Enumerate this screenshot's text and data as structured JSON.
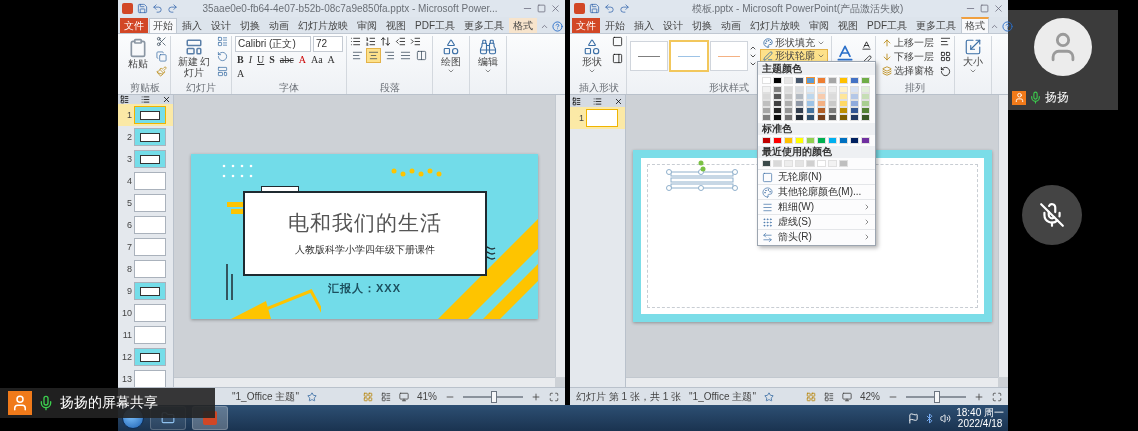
{
  "windows": [
    {
      "title": "35aae0e0-fb64-4e07-b52b-08c7a9e850fa.pptx - Microsoft Power...",
      "tabs": [
        {
          "label": "文件",
          "kind": "file",
          "selected": false
        },
        {
          "label": "开始",
          "kind": "normal",
          "selected": true
        },
        {
          "label": "插入",
          "kind": "normal",
          "selected": false
        },
        {
          "label": "设计",
          "kind": "normal",
          "selected": false
        },
        {
          "label": "切换",
          "kind": "normal",
          "selected": false
        },
        {
          "label": "动画",
          "kind": "normal",
          "selected": false
        },
        {
          "label": "幻灯片放映",
          "kind": "normal",
          "selected": false
        },
        {
          "label": "审阅",
          "kind": "normal",
          "selected": false
        },
        {
          "label": "视图",
          "kind": "normal",
          "selected": false
        },
        {
          "label": "PDF工具",
          "kind": "normal",
          "selected": false
        },
        {
          "label": "更多工具",
          "kind": "normal",
          "selected": false
        },
        {
          "label": "格式",
          "kind": "contextual",
          "selected": false
        }
      ],
      "groups": [
        {
          "kind": "clipboard",
          "label": "剪贴板",
          "button": "粘贴"
        },
        {
          "kind": "new_slide",
          "label": "幻灯片",
          "button": "新建 幻灯片"
        },
        {
          "kind": "font",
          "label": "字体",
          "font_name": "Calibri (正文)",
          "font_size": "72",
          "format_buttons": [
            "B",
            "I",
            "U",
            "S",
            "abc",
            "A",
            "Aa",
            "A",
            "A"
          ]
        },
        {
          "kind": "paragraph",
          "label": "段落",
          "alignments": [
            {
              "selected": false
            },
            {
              "selected": true
            },
            {
              "selected": false
            },
            {
              "selected": false
            },
            {
              "selected": false
            }
          ]
        },
        {
          "kind": "drawing",
          "button": "绘图"
        },
        {
          "kind": "editing",
          "button": "编辑"
        }
      ],
      "slides": [
        {
          "number": "1",
          "kind": "accent",
          "selected": true
        },
        {
          "number": "2",
          "kind": "accent",
          "selected": false
        },
        {
          "number": "3",
          "kind": "accent",
          "selected": false
        },
        {
          "number": "4",
          "kind": "plain",
          "selected": false
        },
        {
          "number": "5",
          "kind": "plain",
          "selected": false
        },
        {
          "number": "6",
          "kind": "plain",
          "selected": false
        },
        {
          "number": "7",
          "kind": "plain",
          "selected": false
        },
        {
          "number": "8",
          "kind": "plain",
          "selected": false
        },
        {
          "number": "9",
          "kind": "accent",
          "selected": false
        },
        {
          "number": "10",
          "kind": "plain",
          "selected": false
        },
        {
          "number": "11",
          "kind": "plain",
          "selected": false
        },
        {
          "number": "12",
          "kind": "accent",
          "selected": false
        },
        {
          "number": "13",
          "kind": "plain",
          "selected": false
        }
      ],
      "slide": {
        "kind": "title",
        "title": "电和我们的生活",
        "subtitle": "人教版科学小学四年级下册课件",
        "reporter": "汇报人：XXX"
      },
      "status": {
        "theme": "\"1_Office 主题\"",
        "zoom": "41%",
        "level": 0.5
      }
    },
    {
      "title": "模板.pptx - Microsoft PowerPoint(产品激活失败)",
      "tabs": [
        {
          "label": "文件",
          "kind": "file",
          "selected": false
        },
        {
          "label": "开始",
          "kind": "normal",
          "selected": false
        },
        {
          "label": "插入",
          "kind": "normal",
          "selected": false
        },
        {
          "label": "设计",
          "kind": "normal",
          "selected": false
        },
        {
          "label": "切换",
          "kind": "normal",
          "selected": false
        },
        {
          "label": "动画",
          "kind": "normal",
          "selected": false
        },
        {
          "label": "幻灯片放映",
          "kind": "normal",
          "selected": false
        },
        {
          "label": "审阅",
          "kind": "normal",
          "selected": false
        },
        {
          "label": "视图",
          "kind": "normal",
          "selected": false
        },
        {
          "label": "PDF工具",
          "kind": "normal",
          "selected": false
        },
        {
          "label": "更多工具",
          "kind": "normal",
          "selected": false
        },
        {
          "label": "格式",
          "kind": "contextual",
          "selected": true
        }
      ],
      "groups": [
        {
          "kind": "shapes",
          "label": "插入形状",
          "button": "形状"
        },
        {
          "kind": "styles",
          "label": "形状样式",
          "styles": [
            {
              "color": "#7f7f7f",
              "selected": false
            },
            {
              "color": "#9dc3e6",
              "selected": true
            },
            {
              "color": "#f4b183",
              "selected": false
            }
          ],
          "items": [
            {
              "label": "形状填充",
              "highlighted": false
            },
            {
              "label": "形状轮廓",
              "highlighted": true
            }
          ]
        },
        {
          "kind": "wordart"
        },
        {
          "kind": "arrange",
          "label": "排列",
          "items": [
            {
              "label": "上移一层",
              "highlighted": false
            },
            {
              "label": "下移一层",
              "highlighted": false
            },
            {
              "label": "选择窗格",
              "highlighted": false
            }
          ]
        },
        {
          "kind": "size",
          "button": "大小"
        }
      ],
      "slides": [
        {
          "number": "1",
          "kind": "plain",
          "selected": true
        }
      ],
      "slide": {
        "kind": "blank"
      },
      "status": {
        "slide_info": "幻灯片 第 1 张，共 1 张",
        "theme": "\"1_Office 主题\"",
        "zoom": "42%",
        "level": 0.5
      },
      "menu": {
        "theme_heading": "主题颜色",
        "theme_colors": [
          {
            "color": "#ffffff",
            "selected": false
          },
          {
            "color": "#000000",
            "selected": false
          },
          {
            "color": "#e7e6e6",
            "selected": false
          },
          {
            "color": "#44546a",
            "selected": false
          },
          {
            "color": "#5b9bd5",
            "selected": true
          },
          {
            "color": "#ed7d31",
            "selected": false
          },
          {
            "color": "#a5a5a5",
            "selected": false
          },
          {
            "color": "#ffc000",
            "selected": false
          },
          {
            "color": "#4472c4",
            "selected": false
          },
          {
            "color": "#70ad47",
            "selected": false
          }
        ],
        "standard_heading": "标准色",
        "standard_colors": [
          {
            "color": "#c00000"
          },
          {
            "color": "#ff0000"
          },
          {
            "color": "#ffc000"
          },
          {
            "color": "#ffff00"
          },
          {
            "color": "#92d050"
          },
          {
            "color": "#00b050"
          },
          {
            "color": "#00b0f0"
          },
          {
            "color": "#0070c0"
          },
          {
            "color": "#002060"
          },
          {
            "color": "#7030a0"
          }
        ],
        "recent_heading": "最近使用的颜色",
        "recent_colors": [
          {
            "color": "#3b4a4a"
          },
          {
            "color": "#d9d9d9"
          },
          {
            "color": "#ededed"
          },
          {
            "color": "#e4e4e4"
          },
          {
            "color": "#d0d0d0"
          },
          {
            "color": "#ffffff"
          },
          {
            "color": "#f2f2f2"
          },
          {
            "color": "#bfbfbf"
          }
        ],
        "items": [
          {
            "label": "无轮廓(N)",
            "kind": "no_outline",
            "submenu": false
          },
          {
            "label": "其他轮廓颜色(M)...",
            "kind": "more_colors",
            "submenu": false
          },
          {
            "label": "粗细(W)",
            "kind": "weight",
            "submenu": true
          },
          {
            "label": "虚线(S)",
            "kind": "dashes",
            "submenu": true
          },
          {
            "label": "箭头(R)",
            "kind": "arrows",
            "submenu": true
          }
        ]
      }
    }
  ],
  "taskbar": {
    "time": "18:40 周一",
    "date": "2022/4/18"
  },
  "video_tile": {
    "name": "扬扬"
  },
  "share_label": "扬扬的屏幕共享"
}
